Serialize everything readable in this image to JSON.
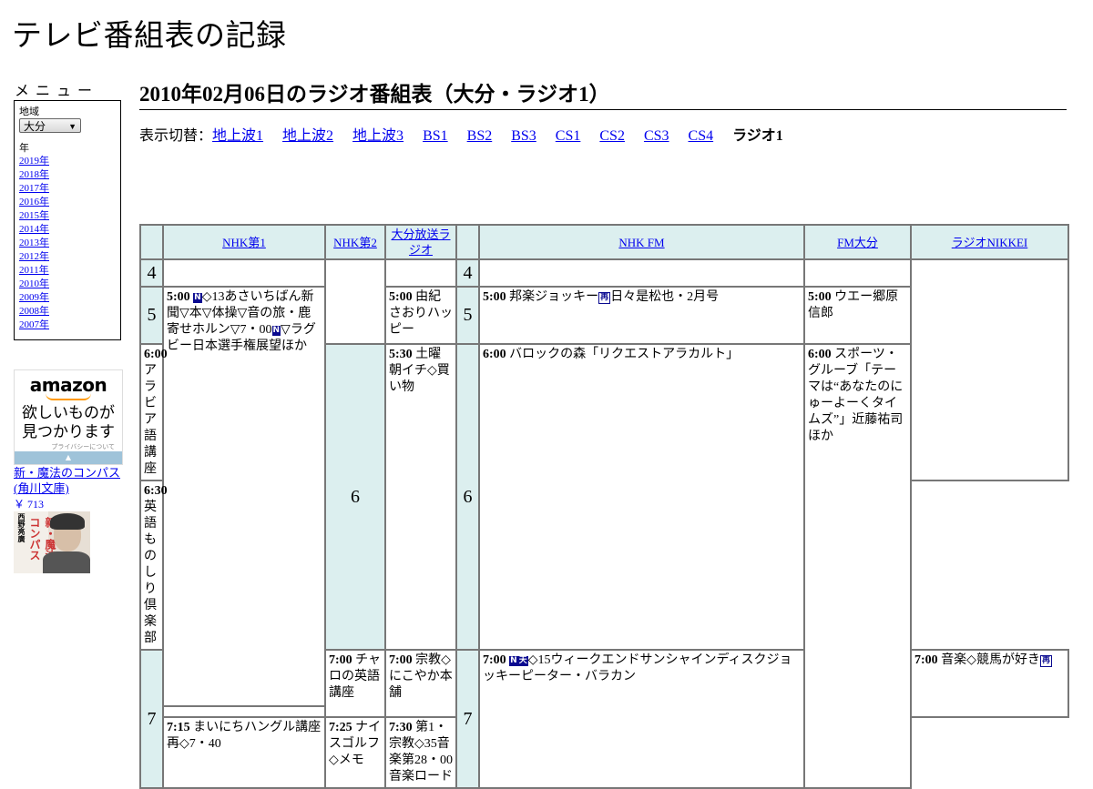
{
  "site_title": "テレビ番組表の記録",
  "menu": {
    "heading": "メニュー",
    "region_label": "地域",
    "region_value": "大分",
    "year_label": "年",
    "years": [
      "2019年",
      "2018年",
      "2017年",
      "2016年",
      "2015年",
      "2014年",
      "2013年",
      "2012年",
      "2011年",
      "2010年",
      "2009年",
      "2008年",
      "2007年"
    ]
  },
  "ad": {
    "logo": "amazon",
    "copy_line1": "欲しいものが",
    "copy_line2": "見つかります",
    "privacy": "プライバシーについて",
    "book_title": "新・魔法のコンパス (角川文庫)",
    "book_price": "￥ 713",
    "cover_author": "西野亮廣",
    "cover_title": "新・魔法のコンパス"
  },
  "page_heading": "2010年02月06日のラジオ番組表（大分・ラジオ1）",
  "switcher": {
    "label": "表示切替：",
    "items": [
      "地上波1",
      "地上波2",
      "地上波3",
      "BS1",
      "BS2",
      "BS3",
      "CS1",
      "CS2",
      "CS3",
      "CS4"
    ],
    "current": "ラジオ1"
  },
  "channels": {
    "nhk1": "NHK第1",
    "nhk2": "NHK第2",
    "obs": "大分放送ラジオ",
    "nhkfm": "NHK FM",
    "fmoita": "FM大分",
    "nikkei": "ラジオNIKKEI"
  },
  "hours": [
    "4",
    "5",
    "6",
    "7"
  ],
  "programs": {
    "nhk1_0500": {
      "time": "5:00",
      "badge": "N",
      "text": "◇13あさいちばん新聞▽本▽体操▽音の旅・鹿寄せホルン▽7・00",
      "badge2": "N",
      "text2": "▽ラグビー日本選手権展望ほか"
    },
    "nhk2_0600": {
      "time": "6:00",
      "text": "アラビア語講座"
    },
    "nhk2_0630": {
      "time": "6:30",
      "text": "英語ものしり倶楽部"
    },
    "nhk2_0700": {
      "time": "7:00",
      "text": "チャロの英語講座"
    },
    "nhk2_0715": {
      "time": "7:15",
      "text": "まいにちハングル講座",
      "extra": "再◇7・40"
    },
    "obs_0500": {
      "time": "5:00",
      "text": "由紀さおりハッピー"
    },
    "obs_0530": {
      "time": "5:30",
      "text": "土曜朝イチ◇買い物"
    },
    "obs_0700": {
      "time": "7:00",
      "text": "宗教◇にこやか本舗"
    },
    "obs_0725": {
      "time": "7:25",
      "text": "ナイスゴルフ◇メモ"
    },
    "fm_0500": {
      "time": "5:00",
      "text": "邦楽ジョッキー",
      "badge": "再",
      "text2": "日々是松也・2月号"
    },
    "fm_0600": {
      "time": "6:00",
      "text": "バロックの森「リクエストアラカルト」"
    },
    "fm_0700": {
      "time": "7:00",
      "badge": "N",
      "badge2": "天",
      "text": "◇15ウィークエンドサンシャインディスクジョッキーピーター・バラカン"
    },
    "fmo_0500": {
      "time": "5:00",
      "text": "ウエー郷原信郎"
    },
    "fmo_0600": {
      "time": "6:00",
      "text": "スポーツ・グルーブ「テーマは“あなたのにゅーよーくタイムズ”」近藤祐司ほか"
    },
    "nik_0700": {
      "time": "7:00",
      "text": "音楽◇競馬が好き",
      "badge": "再"
    },
    "nik_0730": {
      "time": "7:30",
      "text": "第1・宗教◇35音楽第28・00音楽ロード"
    }
  }
}
